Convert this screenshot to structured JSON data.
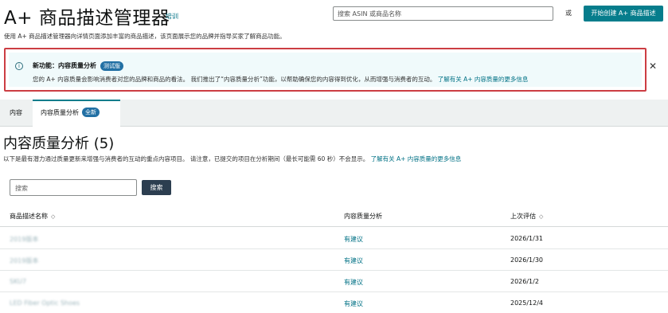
{
  "header": {
    "title": "A+ 商品描述管理器",
    "training_link": "培训",
    "search_placeholder": "搜索 ASIN 或商品名称",
    "or_text": "或",
    "create_button": "开始创建 A+ 商品描述"
  },
  "description": "使用 A+ 商品描述管理器向详情页面添加丰富的商品描述，该页面展示您的品牌并指导买家了解商品功能。",
  "alert": {
    "icon": "info-icon",
    "title": "新功能：内容质量分析",
    "badge": "测试版",
    "body": "您的 A+ 内容质量会影响消费者对您的品牌和商品的看法。 我们推出了“内容质量分析”功能，以帮助确保您的内容得到优化，从而增强与消费者的互动。",
    "link": "了解有关 A+ 内容质量的更多信息",
    "close": "✕"
  },
  "tabs": [
    {
      "label": "内容"
    },
    {
      "label": "内容质量分析",
      "badge": "全新"
    }
  ],
  "section": {
    "title": "内容质量分析 (5)",
    "desc": "以下是最有潜力通过质量更新来增强与消费者的互动的重点内容项目。 请注意，已提交的项目在分析期间（最长可能需 60 秒）不会显示。",
    "link": "了解有关 A+ 内容质量的更多信息"
  },
  "search": {
    "placeholder": "搜索",
    "button": "搜索"
  },
  "table": {
    "columns": [
      "商品描述名称",
      "内容质量分析",
      "上次评估"
    ],
    "sort_icon": "◇",
    "rows": [
      {
        "name": "2019版本",
        "suggestion": "有建议",
        "date": "2026/1/31"
      },
      {
        "name": "2019版本",
        "suggestion": "有建议",
        "date": "2026/1/30"
      },
      {
        "name": "SKU7",
        "suggestion": "有建议",
        "date": "2026/1/2"
      },
      {
        "name": "LED Fiber Optic Shoes",
        "suggestion": "有建议",
        "date": "2025/12/4"
      }
    ]
  },
  "colors": {
    "accent": "#067d8c",
    "link": "#007185",
    "badge": "#2270a4",
    "alert_border": "#cc3d43"
  }
}
